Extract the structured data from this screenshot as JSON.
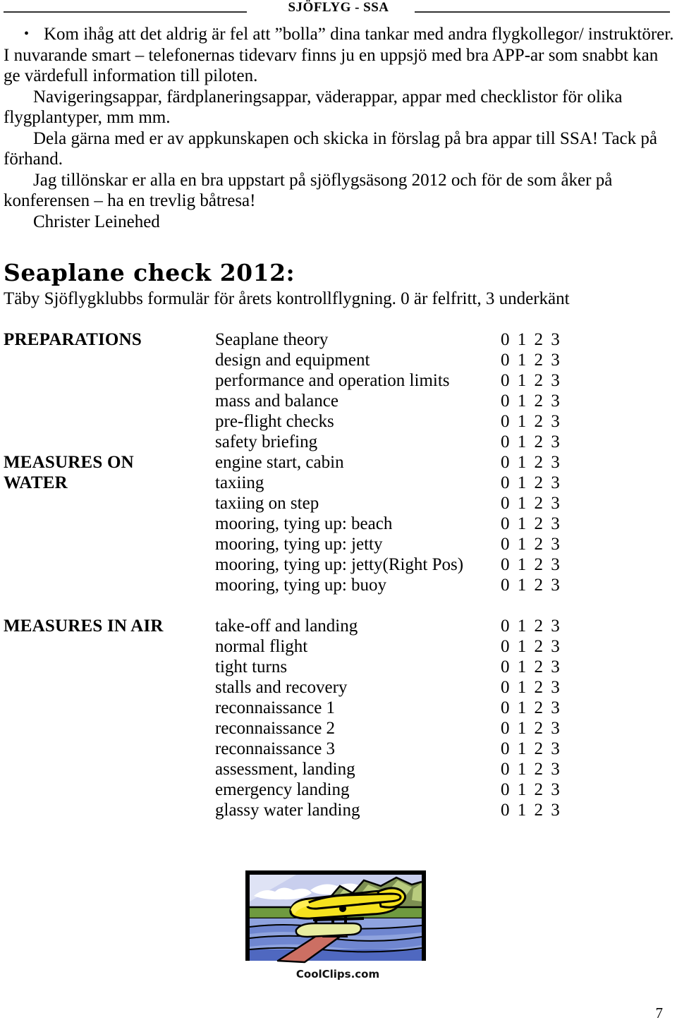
{
  "header": {
    "title": "SJÖFLYG - SSA"
  },
  "intro": {
    "bullet_marker": "•",
    "bullet_text": "Kom ihåg att det aldrig är fel att ”bolla” dina tankar med andra flygkollegor/ instruktörer.",
    "paragraphs": [
      "I nuvarande smart – telefonernas tidevarv finns ju en uppsjö med bra APP-ar som snabbt kan ge värdefull information till piloten.",
      "Navigeringsappar, färdplaneringsappar, väderappar, appar med checklistor för olika flygplantyper, mm mm.",
      "Dela gärna med er av appkunskapen och skicka in förslag på bra appar till SSA! Tack på förhand.",
      "Jag tillönskar er alla en bra uppstart på sjöflygsäsong 2012 och för de som åker på konferensen – ha en trevlig båtresa!",
      "Christer Leinehed"
    ]
  },
  "section": {
    "title": "Seaplane check 2012:",
    "subtitle": "Täby Sjöflygklubbs formulär för årets kontrollflygning. 0 är felfritt, 3 underkänt"
  },
  "checklist": {
    "score_scale": "0 1 2 3",
    "rows": [
      {
        "group": "PREPARATIONS",
        "item": "Seaplane theory",
        "score": "0 1 2 3"
      },
      {
        "group": "",
        "item": "design and equipment",
        "score": "0 1 2 3"
      },
      {
        "group": "",
        "item": "performance and operation limits",
        "score": "0 1 2 3"
      },
      {
        "group": "",
        "item": "mass and balance",
        "score": "0 1 2 3"
      },
      {
        "group": "",
        "item": "pre-flight checks",
        "score": "0 1 2 3"
      },
      {
        "group": "",
        "item": "safety briefing",
        "score": "0 1 2 3"
      },
      {
        "group": "MEASURES ON",
        "item": "engine start, cabin",
        "score": "0 1 2 3"
      },
      {
        "group": "WATER",
        "item": "taxiing",
        "score": "0 1 2 3"
      },
      {
        "group": "",
        "item": "taxiing on step",
        "score": "0 1 2 3"
      },
      {
        "group": "",
        "item": "mooring, tying up: beach",
        "score": "0 1 2 3"
      },
      {
        "group": "",
        "item": "mooring, tying up: jetty",
        "score": "0 1 2 3"
      },
      {
        "group": "",
        "item": "mooring, tying up: jetty(Right Pos)",
        "score": "0 1 2 3"
      },
      {
        "group": "",
        "item": "mooring, tying up: buoy",
        "score": "0 1 2 3"
      },
      {
        "group": "",
        "item": "",
        "score": ""
      },
      {
        "group": "MEASURES IN AIR",
        "item": "take-off and landing",
        "score": "0 1 2 3"
      },
      {
        "group": "",
        "item": "normal flight",
        "score": "0 1 2 3"
      },
      {
        "group": "",
        "item": "tight turns",
        "score": "0 1 2 3"
      },
      {
        "group": "",
        "item": "stalls and recovery",
        "score": "0 1 2 3"
      },
      {
        "group": "",
        "item": "reconnaissance 1",
        "score": "0 1 2 3"
      },
      {
        "group": "",
        "item": "reconnaissance 2",
        "score": "0 1 2 3"
      },
      {
        "group": "",
        "item": "reconnaissance 3",
        "score": "0 1 2 3"
      },
      {
        "group": "",
        "item": "assessment, landing",
        "score": "0 1 2 3"
      },
      {
        "group": "",
        "item": "emergency landing",
        "score": "0 1 2 3"
      },
      {
        "group": "",
        "item": "glassy water landing",
        "score": "0 1 2 3"
      }
    ]
  },
  "figure": {
    "alt": "seaplane-clipart",
    "caption": "CoolClips.com",
    "colors": {
      "sky": "#c9cfee",
      "cloud": "#ffffff",
      "hill_light": "#b9cc7e",
      "hill_dark": "#7d8f52",
      "shore": "#6f9a3f",
      "water_light": "#8fa3de",
      "water_mid": "#6f86d0",
      "water_dark": "#4f68c0",
      "plane": "#f5e21e",
      "float": "#e8eda0",
      "dock": "#cc6f63",
      "outline": "#000000"
    }
  },
  "footer": {
    "page_number": "7"
  }
}
